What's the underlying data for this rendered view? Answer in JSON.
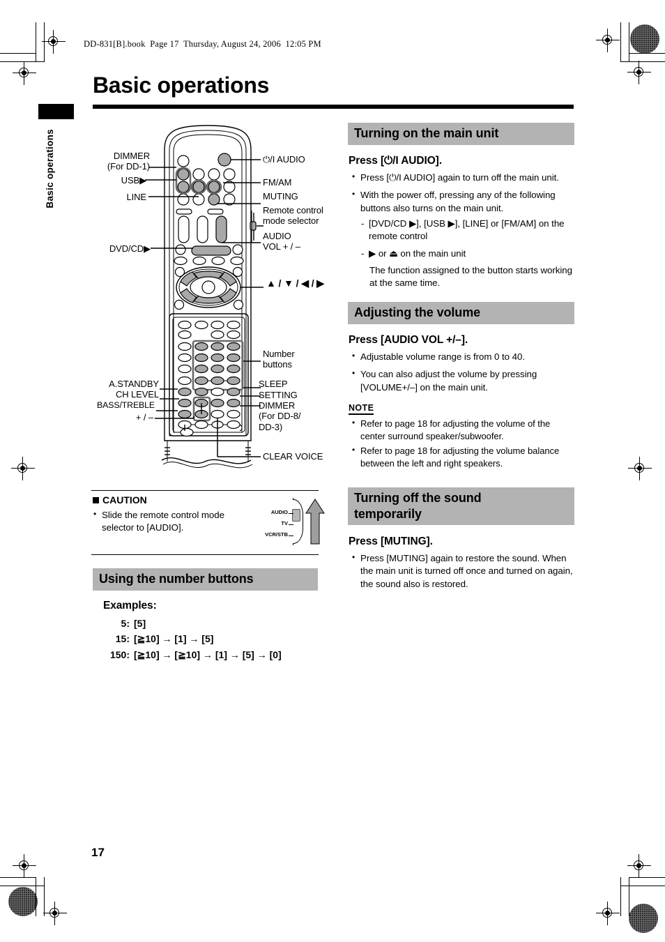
{
  "document": {
    "file_header": "DD-831[B].book  Page 17  Thursday, August 24, 2006  12:05 PM",
    "page_title": "Basic operations",
    "side_tab": "Basic operations",
    "page_number": "17"
  },
  "remote_callouts": {
    "left": [
      {
        "name": "dimmer",
        "line1": "DIMMER",
        "line2": "(For DD-1)"
      },
      {
        "name": "usb",
        "line1": "USB▶"
      },
      {
        "name": "line",
        "line1": "LINE"
      },
      {
        "name": "dvd-cd",
        "line1": "DVD/CD▶"
      },
      {
        "name": "a-standby",
        "line1": "A.STANDBY"
      },
      {
        "name": "ch-level",
        "line1": "CH LEVEL"
      },
      {
        "name": "bass-treble",
        "line1": "BASS/TREBLE"
      },
      {
        "name": "plus-minus",
        "line1": "+ / –"
      }
    ],
    "right": [
      {
        "name": "power-audio",
        "line1": "⏻/I  AUDIO"
      },
      {
        "name": "fm-am",
        "line1": "FM/AM"
      },
      {
        "name": "muting",
        "line1": "MUTING"
      },
      {
        "name": "mode-selector",
        "line1": "Remote control",
        "line2": "mode selector"
      },
      {
        "name": "audio-vol",
        "line1": "AUDIO",
        "line2": "VOL  + / –"
      },
      {
        "name": "cursor-keys",
        "line1": "▲ / ▼ / ◀ / ▶"
      },
      {
        "name": "number-buttons",
        "line1": "Number",
        "line2": "buttons"
      },
      {
        "name": "sleep",
        "line1": "SLEEP"
      },
      {
        "name": "setting",
        "line1": "SETTING"
      },
      {
        "name": "dimmer-dd8",
        "line1": "DIMMER",
        "line2": "(For DD-8/",
        "line3": "DD-3)"
      },
      {
        "name": "clear-voice",
        "line1": "CLEAR VOICE"
      }
    ]
  },
  "caution": {
    "title": "CAUTION",
    "bullet": "Slide the remote control mode selector to [AUDIO].",
    "selector_labels": [
      "AUDIO",
      "TV",
      "VCR/STB"
    ]
  },
  "number_buttons_section": {
    "heading": "Using the number buttons",
    "examples_label": "Examples:",
    "examples": [
      {
        "value": "5:",
        "sequence": "[5]"
      },
      {
        "value": "15:",
        "sequence": "[≧10] → [1] → [5]"
      },
      {
        "value": "150:",
        "sequence": "[≧10] → [≧10] → [1] → [5] → [0]"
      }
    ]
  },
  "turning_on": {
    "heading": "Turning on the main unit",
    "subheading": "Press [⏻/I AUDIO].",
    "bullets": [
      "Press [⏻/I AUDIO] again to turn off the main unit.",
      "With the power off, pressing any of the following buttons also turns on the main unit."
    ],
    "dashes": [
      "[DVD/CD ▶], [USB ▶], [LINE] or [FM/AM] on the remote control",
      "▶ or ⏏ on the main unit"
    ],
    "closing": "The function assigned to the button starts working at the same time."
  },
  "adjusting_volume": {
    "heading": "Adjusting the volume",
    "subheading": "Press [AUDIO VOL +/–].",
    "bullets": [
      "Adjustable volume range is from 0 to 40.",
      "You can also adjust the volume by pressing [VOLUME+/–] on the main unit."
    ],
    "note_label": "NOTE",
    "notes": [
      "Refer to page 18 for adjusting the volume of the center surround speaker/subwoofer.",
      "Refer to page 18 for adjusting the volume balance between the left and right speakers."
    ]
  },
  "turning_off_sound": {
    "heading_line1": "Turning off the sound",
    "heading_line2": "temporarily",
    "subheading": "Press [MUTING].",
    "bullets": [
      "Press [MUTING] again to restore the sound. When the main unit is turned off once and turned on again, the sound also is restored."
    ]
  },
  "colors": {
    "section_bar": "#b3b3b3",
    "button_fill": "#a8a8a8",
    "rule": "#000000"
  }
}
